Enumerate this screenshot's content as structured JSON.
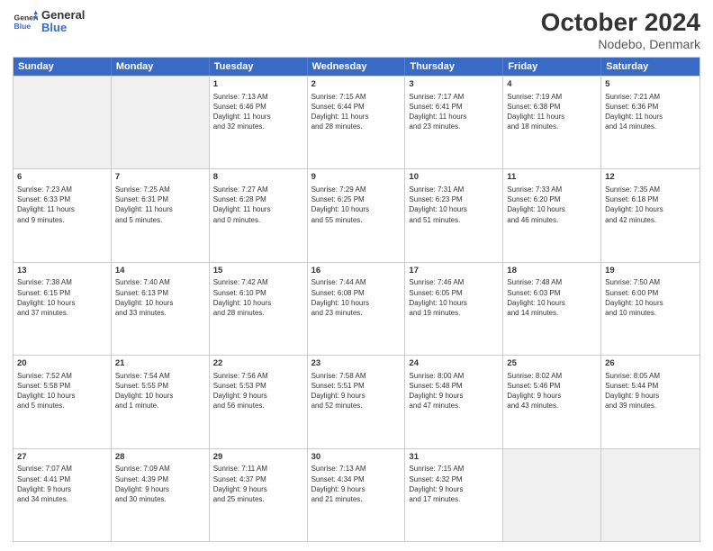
{
  "header": {
    "logo_line1": "General",
    "logo_line2": "Blue",
    "month_title": "October 2024",
    "location": "Nodebo, Denmark"
  },
  "weekdays": [
    "Sunday",
    "Monday",
    "Tuesday",
    "Wednesday",
    "Thursday",
    "Friday",
    "Saturday"
  ],
  "rows": [
    [
      {
        "day": "",
        "info": "",
        "shaded": true
      },
      {
        "day": "",
        "info": "",
        "shaded": true
      },
      {
        "day": "1",
        "info": "Sunrise: 7:13 AM\nSunset: 6:46 PM\nDaylight: 11 hours\nand 32 minutes."
      },
      {
        "day": "2",
        "info": "Sunrise: 7:15 AM\nSunset: 6:44 PM\nDaylight: 11 hours\nand 28 minutes."
      },
      {
        "day": "3",
        "info": "Sunrise: 7:17 AM\nSunset: 6:41 PM\nDaylight: 11 hours\nand 23 minutes."
      },
      {
        "day": "4",
        "info": "Sunrise: 7:19 AM\nSunset: 6:38 PM\nDaylight: 11 hours\nand 18 minutes."
      },
      {
        "day": "5",
        "info": "Sunrise: 7:21 AM\nSunset: 6:36 PM\nDaylight: 11 hours\nand 14 minutes."
      }
    ],
    [
      {
        "day": "6",
        "info": "Sunrise: 7:23 AM\nSunset: 6:33 PM\nDaylight: 11 hours\nand 9 minutes."
      },
      {
        "day": "7",
        "info": "Sunrise: 7:25 AM\nSunset: 6:31 PM\nDaylight: 11 hours\nand 5 minutes."
      },
      {
        "day": "8",
        "info": "Sunrise: 7:27 AM\nSunset: 6:28 PM\nDaylight: 11 hours\nand 0 minutes."
      },
      {
        "day": "9",
        "info": "Sunrise: 7:29 AM\nSunset: 6:25 PM\nDaylight: 10 hours\nand 55 minutes."
      },
      {
        "day": "10",
        "info": "Sunrise: 7:31 AM\nSunset: 6:23 PM\nDaylight: 10 hours\nand 51 minutes."
      },
      {
        "day": "11",
        "info": "Sunrise: 7:33 AM\nSunset: 6:20 PM\nDaylight: 10 hours\nand 46 minutes."
      },
      {
        "day": "12",
        "info": "Sunrise: 7:35 AM\nSunset: 6:18 PM\nDaylight: 10 hours\nand 42 minutes."
      }
    ],
    [
      {
        "day": "13",
        "info": "Sunrise: 7:38 AM\nSunset: 6:15 PM\nDaylight: 10 hours\nand 37 minutes."
      },
      {
        "day": "14",
        "info": "Sunrise: 7:40 AM\nSunset: 6:13 PM\nDaylight: 10 hours\nand 33 minutes."
      },
      {
        "day": "15",
        "info": "Sunrise: 7:42 AM\nSunset: 6:10 PM\nDaylight: 10 hours\nand 28 minutes."
      },
      {
        "day": "16",
        "info": "Sunrise: 7:44 AM\nSunset: 6:08 PM\nDaylight: 10 hours\nand 23 minutes."
      },
      {
        "day": "17",
        "info": "Sunrise: 7:46 AM\nSunset: 6:05 PM\nDaylight: 10 hours\nand 19 minutes."
      },
      {
        "day": "18",
        "info": "Sunrise: 7:48 AM\nSunset: 6:03 PM\nDaylight: 10 hours\nand 14 minutes."
      },
      {
        "day": "19",
        "info": "Sunrise: 7:50 AM\nSunset: 6:00 PM\nDaylight: 10 hours\nand 10 minutes."
      }
    ],
    [
      {
        "day": "20",
        "info": "Sunrise: 7:52 AM\nSunset: 5:58 PM\nDaylight: 10 hours\nand 5 minutes."
      },
      {
        "day": "21",
        "info": "Sunrise: 7:54 AM\nSunset: 5:55 PM\nDaylight: 10 hours\nand 1 minute."
      },
      {
        "day": "22",
        "info": "Sunrise: 7:56 AM\nSunset: 5:53 PM\nDaylight: 9 hours\nand 56 minutes."
      },
      {
        "day": "23",
        "info": "Sunrise: 7:58 AM\nSunset: 5:51 PM\nDaylight: 9 hours\nand 52 minutes."
      },
      {
        "day": "24",
        "info": "Sunrise: 8:00 AM\nSunset: 5:48 PM\nDaylight: 9 hours\nand 47 minutes."
      },
      {
        "day": "25",
        "info": "Sunrise: 8:02 AM\nSunset: 5:46 PM\nDaylight: 9 hours\nand 43 minutes."
      },
      {
        "day": "26",
        "info": "Sunrise: 8:05 AM\nSunset: 5:44 PM\nDaylight: 9 hours\nand 39 minutes."
      }
    ],
    [
      {
        "day": "27",
        "info": "Sunrise: 7:07 AM\nSunset: 4:41 PM\nDaylight: 9 hours\nand 34 minutes."
      },
      {
        "day": "28",
        "info": "Sunrise: 7:09 AM\nSunset: 4:39 PM\nDaylight: 9 hours\nand 30 minutes."
      },
      {
        "day": "29",
        "info": "Sunrise: 7:11 AM\nSunset: 4:37 PM\nDaylight: 9 hours\nand 25 minutes."
      },
      {
        "day": "30",
        "info": "Sunrise: 7:13 AM\nSunset: 4:34 PM\nDaylight: 9 hours\nand 21 minutes."
      },
      {
        "day": "31",
        "info": "Sunrise: 7:15 AM\nSunset: 4:32 PM\nDaylight: 9 hours\nand 17 minutes."
      },
      {
        "day": "",
        "info": "",
        "shaded": true
      },
      {
        "day": "",
        "info": "",
        "shaded": true
      }
    ]
  ]
}
